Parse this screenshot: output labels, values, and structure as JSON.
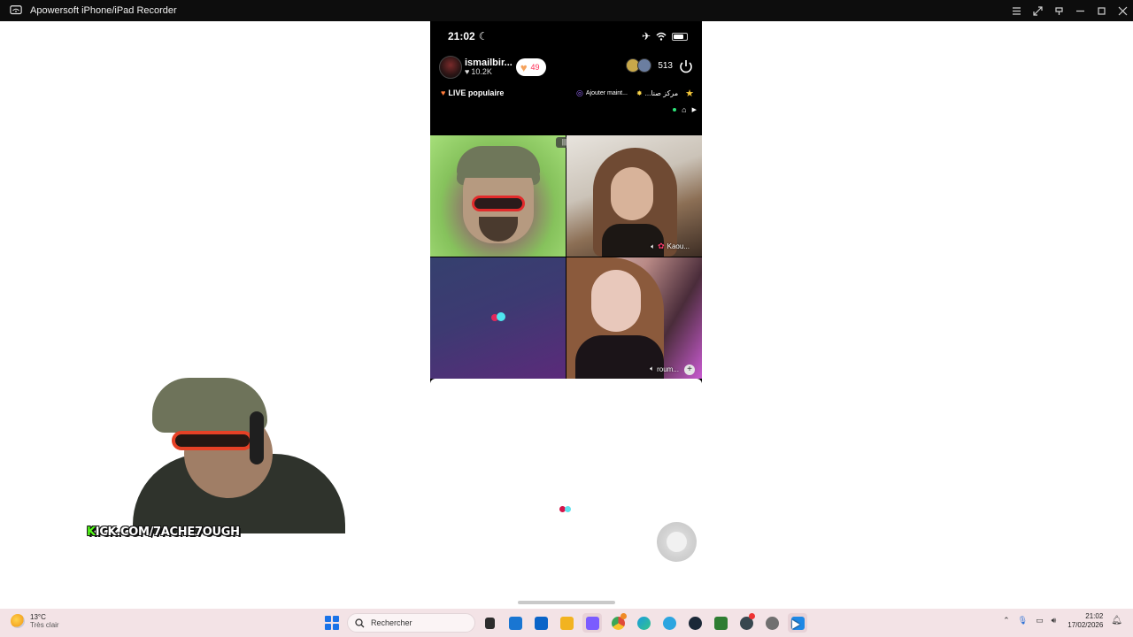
{
  "window": {
    "title": "Apowersoft iPhone/iPad Recorder",
    "controls": [
      "list-icon",
      "fullscreen-icon",
      "pin-icon",
      "minimize-icon",
      "maximize-icon",
      "close-icon"
    ]
  },
  "phone": {
    "status": {
      "time": "21:02",
      "icons": [
        "moon-icon",
        "airplane-icon",
        "wifi-icon",
        "battery-icon"
      ]
    },
    "live": {
      "host_name": "ismailbir...",
      "host_likes": "10.2K",
      "follow_count": "49",
      "viewer_count": "513",
      "popular_label": "LIVE populaire",
      "add_label": "Ajouter maint...",
      "arabic_label": "...مركز صنا"
    },
    "guests": [
      {
        "name": "",
        "speaker": false
      },
      {
        "name": "Kaou...",
        "speaker": true
      },
      {
        "name": "",
        "speaker": false
      },
      {
        "name": "roum...",
        "speaker": true
      }
    ]
  },
  "overlay": {
    "kick_prefix": "K",
    "kick_rest": "ICK.COM/7ACHE7OUGH"
  },
  "taskbar": {
    "weather_temp": "13°C",
    "weather_desc": "Très clair",
    "search_placeholder": "Rechercher",
    "time": "21:02",
    "date": "17/02/2026",
    "app_colors": [
      "#2d2d2d",
      "#1976d2",
      "#0a64c8",
      "#f2b320",
      "#7b5cff",
      "#e04a3a",
      "#1b9cde",
      "#2ca5e0",
      "#1b2838",
      "#2e7d32",
      "#37474f",
      "#707070",
      "#1e88e5"
    ]
  }
}
